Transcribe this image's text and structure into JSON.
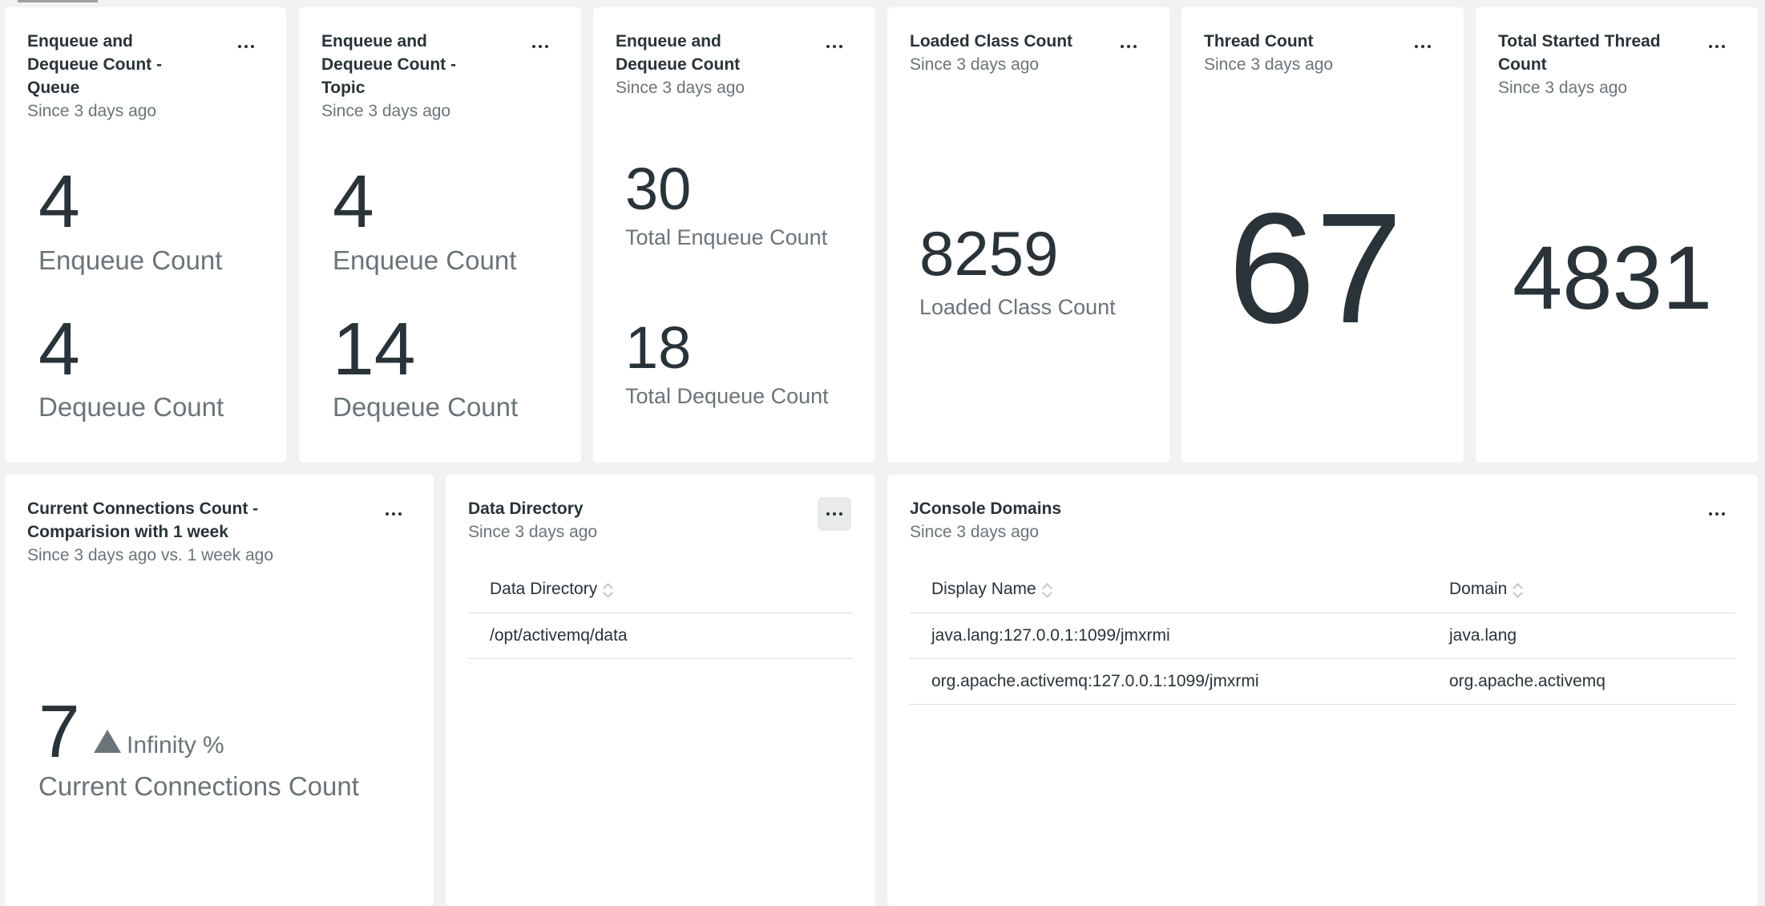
{
  "menu_label": "...",
  "cards": {
    "queue": {
      "title_l1": "Enqueue and",
      "title_l2": "Dequeue Count -",
      "title_l3": "Queue",
      "subtitle": "Since 3 days ago",
      "enqueue_value": "4",
      "enqueue_label": "Enqueue Count",
      "dequeue_value": "4",
      "dequeue_label": "Dequeue Count"
    },
    "topic": {
      "title_l1": "Enqueue and",
      "title_l2": "Dequeue Count -",
      "title_l3": "Topic",
      "subtitle": "Since 3 days ago",
      "enqueue_value": "4",
      "enqueue_label": "Enqueue Count",
      "dequeue_value": "14",
      "dequeue_label": "Dequeue Count"
    },
    "total": {
      "title_l1": "Enqueue and",
      "title_l2": "Dequeue Count",
      "subtitle": "Since 3 days ago",
      "enqueue_value": "30",
      "enqueue_label": "Total Enqueue Count",
      "dequeue_value": "18",
      "dequeue_label": "Total Dequeue Count"
    },
    "loaded_class": {
      "title": "Loaded Class Count",
      "subtitle": "Since 3 days ago",
      "value": "8259",
      "label": "Loaded Class Count"
    },
    "thread": {
      "title": "Thread Count",
      "subtitle": "Since 3 days ago",
      "value": "67"
    },
    "started_thread": {
      "title_l1": "Total Started Thread",
      "title_l2": "Count",
      "subtitle": "Since 3 days ago",
      "value": "4831"
    },
    "connections": {
      "title_l1": "Current Connections Count -",
      "title_l2": "Comparision with 1 week",
      "subtitle": "Since 3 days ago vs. 1 week ago",
      "value": "7",
      "change": "Infinity %",
      "label": "Current Connections Count"
    },
    "data_directory": {
      "title": "Data Directory",
      "subtitle": "Since 3 days ago",
      "column": "Data Directory",
      "rows": [
        "/opt/activemq/data"
      ]
    },
    "jconsole": {
      "title": "JConsole Domains",
      "subtitle": "Since 3 days ago",
      "col_display": "Display Name",
      "col_domain": "Domain",
      "rows": [
        {
          "display": "java.lang:127.0.0.1:1099/jmxrmi",
          "domain": "java.lang"
        },
        {
          "display": "org.apache.activemq:127.0.0.1:1099/jmxrmi",
          "domain": "org.apache.activemq"
        }
      ]
    }
  },
  "icons": {
    "menu": "more-horizontal-icon",
    "sort": "sort-icon",
    "increase": "triangle-up-icon"
  },
  "colors": {
    "background": "#f2f2f2",
    "card": "#ffffff",
    "text": "#293338",
    "muted": "#6b7478"
  }
}
